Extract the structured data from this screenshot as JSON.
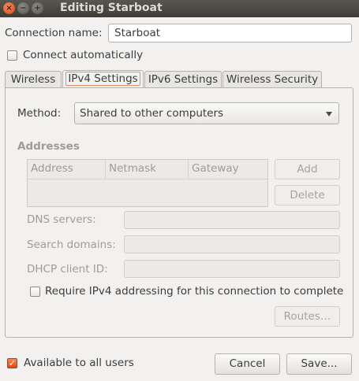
{
  "window": {
    "title": "Editing Starboat",
    "close_glyph": "×",
    "minimize_glyph": "−",
    "maximize_glyph": "+"
  },
  "connection_name": {
    "label": "Connection name:",
    "value": "Starboat"
  },
  "connect_automatically": {
    "label": "Connect automatically",
    "checked": false
  },
  "tabs": [
    {
      "label": "Wireless"
    },
    {
      "label": "IPv4 Settings"
    },
    {
      "label": "IPv6 Settings"
    },
    {
      "label": "Wireless Security"
    }
  ],
  "ipv4": {
    "method_label": "Method:",
    "method_value": "Shared to other computers",
    "addresses_heading": "Addresses",
    "table_headers": [
      "Address",
      "Netmask",
      "Gateway"
    ],
    "add_button": "Add",
    "delete_button": "Delete",
    "dns_label": "DNS servers:",
    "dns_value": "",
    "search_domains_label": "Search domains:",
    "search_domains_value": "",
    "dhcp_client_id_label": "DHCP client ID:",
    "dhcp_client_id_value": "",
    "require_ipv4": {
      "label": "Require IPv4 addressing for this connection to complete",
      "checked": false
    },
    "routes_button": "Routes…"
  },
  "available_to_all_users": {
    "label": "Available to all users",
    "checked": true,
    "check_glyph": "✓"
  },
  "cancel_button": "Cancel",
  "save_button": "Save...",
  "colors": {
    "accent": "#dd4814",
    "titlebar": "#3d3c37"
  }
}
